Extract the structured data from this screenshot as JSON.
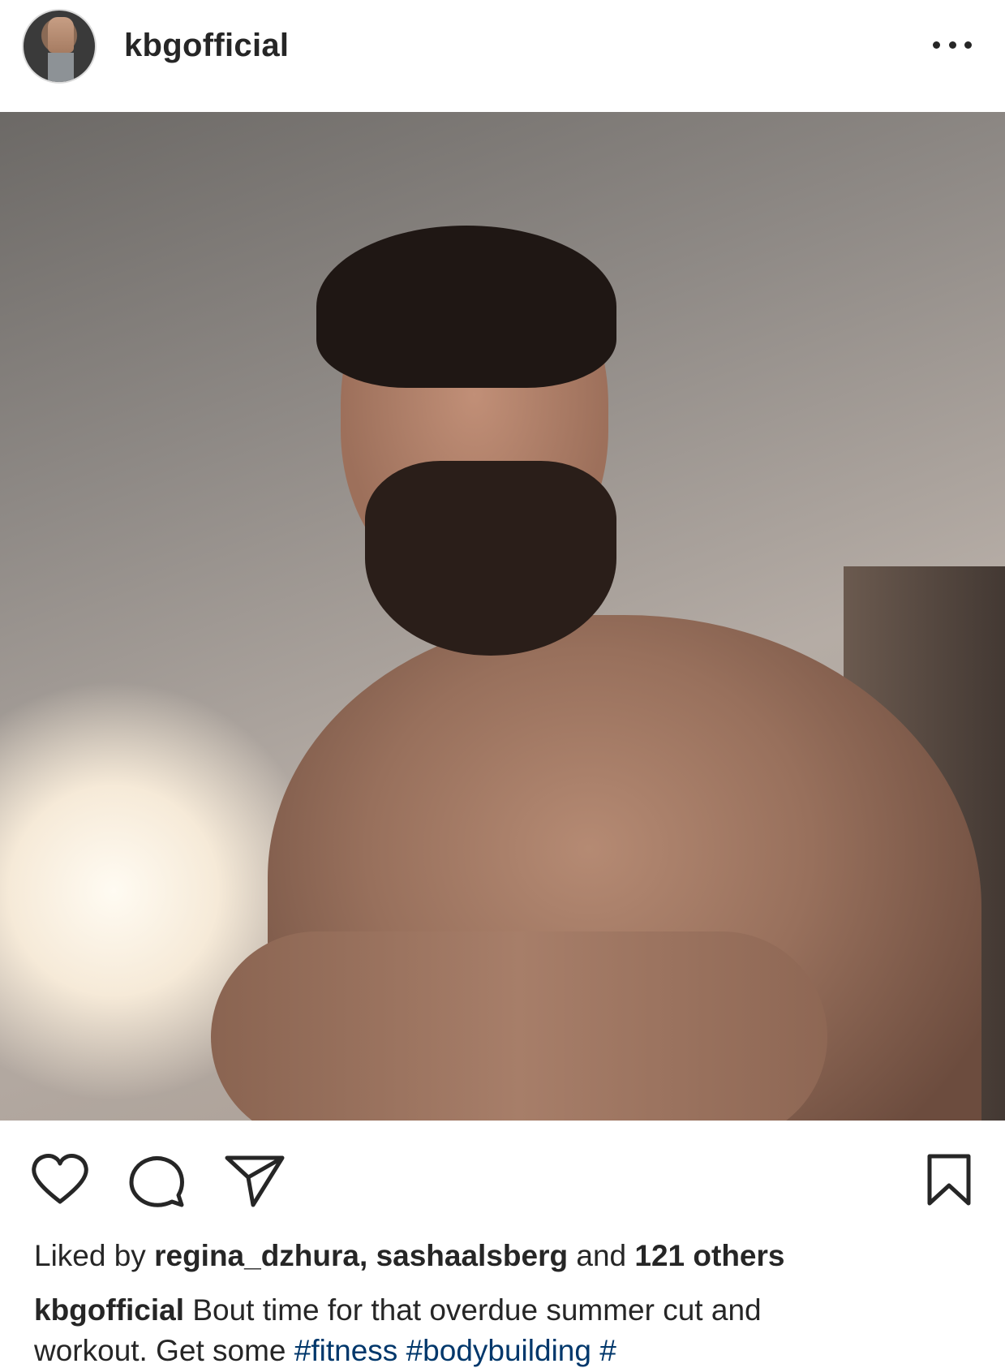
{
  "post": {
    "username": "kbgofficial",
    "more_icon": "more-horizontal-icon",
    "photo_alt": "",
    "actions": {
      "like_icon": "heart-icon",
      "comment_icon": "comment-icon",
      "share_icon": "share-icon",
      "save_icon": "bookmark-icon"
    },
    "likes": {
      "prefix": "Liked by",
      "user1": "regina_dzhura,",
      "user2": "sashaalsberg",
      "conj": "and",
      "others": "121 others"
    },
    "caption": {
      "username": "kbgofficial",
      "text": "Bout time for that overdue summer cut and",
      "line2_text": "workout. Get some ",
      "line2_tags": "#fitness #bodybuilding #"
    }
  }
}
